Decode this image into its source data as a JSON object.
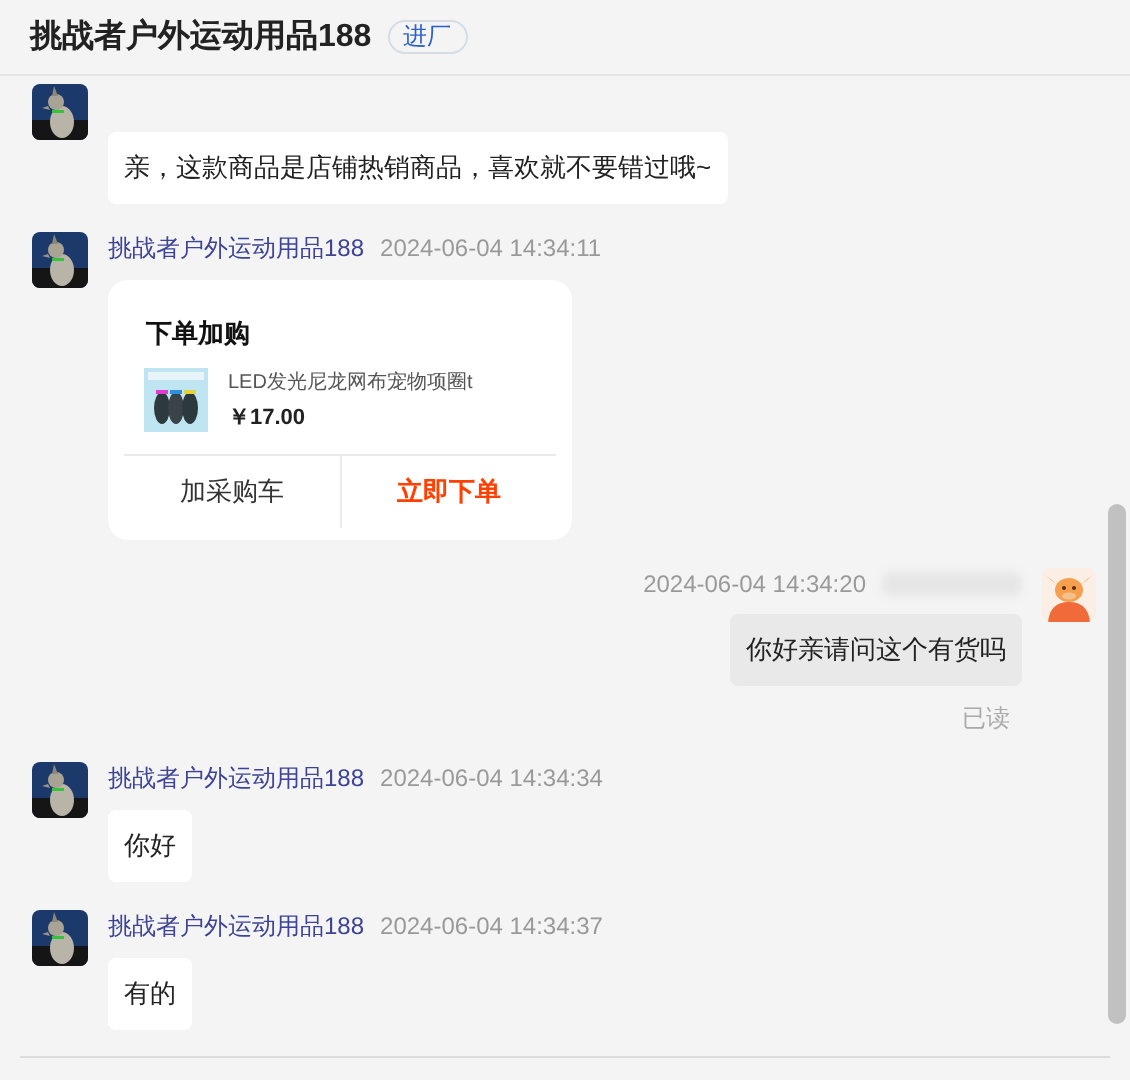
{
  "header": {
    "title": "挑战者户外运动用品188",
    "badge": "进厂"
  },
  "messages": [
    {
      "kind": "text",
      "text": "亲，这款商品是店铺热销商品，喜欢就不要错过哦~"
    },
    {
      "kind": "card",
      "sender": "挑战者户外运动用品188",
      "time": "2024-06-04 14:34:11",
      "card": {
        "title": "下单加购",
        "product": "LED发光尼龙网布宠物项圈t",
        "price": "￥17.00",
        "buttons": [
          {
            "label": "加采购车",
            "kind": "plain"
          },
          {
            "label": "立即下单",
            "kind": "primary"
          }
        ]
      }
    },
    {
      "kind": "sent",
      "time": "2024-06-04 14:34:20",
      "text": "你好亲请问这个有货吗",
      "status": "已读"
    },
    {
      "kind": "text",
      "sender": "挑战者户外运动用品188",
      "time": "2024-06-04 14:34:34",
      "text": "你好"
    },
    {
      "kind": "text",
      "sender": "挑战者户外运动用品188",
      "time": "2024-06-04 14:34:37",
      "text": "有的"
    }
  ]
}
